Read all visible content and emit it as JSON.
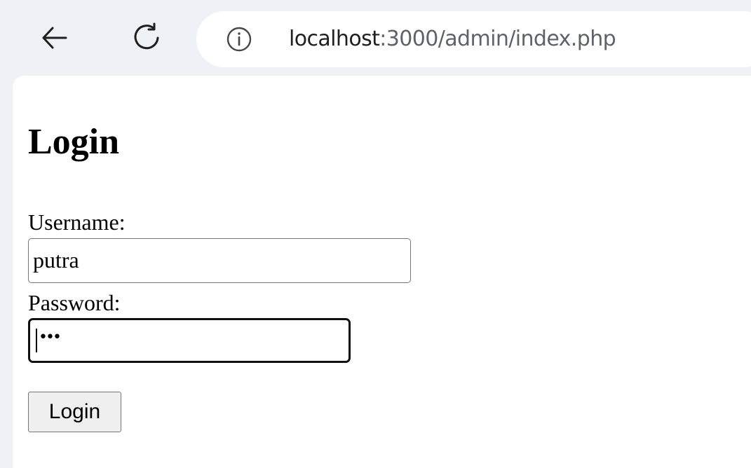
{
  "browser": {
    "url_host": "localhost",
    "url_path": ":3000/admin/index.php",
    "back_icon": "arrow-left-icon",
    "reload_icon": "reload-icon",
    "site_info_icon": "info-circle-icon"
  },
  "page": {
    "title": "Login",
    "username_label": "Username:",
    "username_value": "putra",
    "password_label": "Password:",
    "password_masked": "•••",
    "submit_label": "Login"
  },
  "colors": {
    "toolbar_bg": "#eef1f6",
    "page_bg": "#ffffff",
    "url_path": "#5f6368"
  }
}
